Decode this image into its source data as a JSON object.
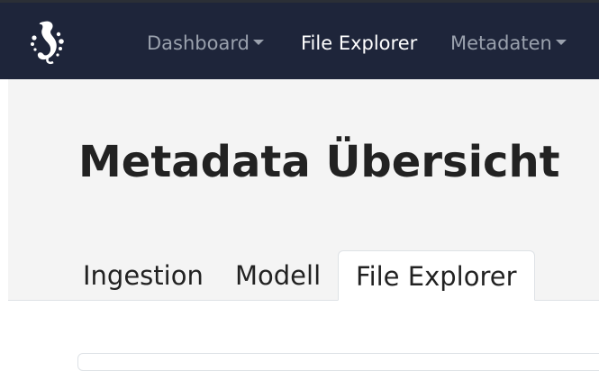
{
  "navbar": {
    "logo_icon": "seahorse-logo-icon",
    "items": [
      {
        "label": "Dashboard",
        "dropdown": true,
        "active": false
      },
      {
        "label": "File Explorer",
        "dropdown": false,
        "active": true
      },
      {
        "label": "Metadaten",
        "dropdown": true,
        "active": false
      }
    ]
  },
  "hero": {
    "title": "Metadata Übersicht"
  },
  "tabs": [
    {
      "label": "Ingestion",
      "active": false
    },
    {
      "label": "Modell",
      "active": false
    },
    {
      "label": "File Explorer",
      "active": true
    }
  ],
  "colors": {
    "navbar_bg": "#1e253a",
    "nav_text": "#9aa1ad",
    "nav_active": "#ffffff",
    "hero_bg": "#f4f4f4",
    "text": "#222222"
  }
}
